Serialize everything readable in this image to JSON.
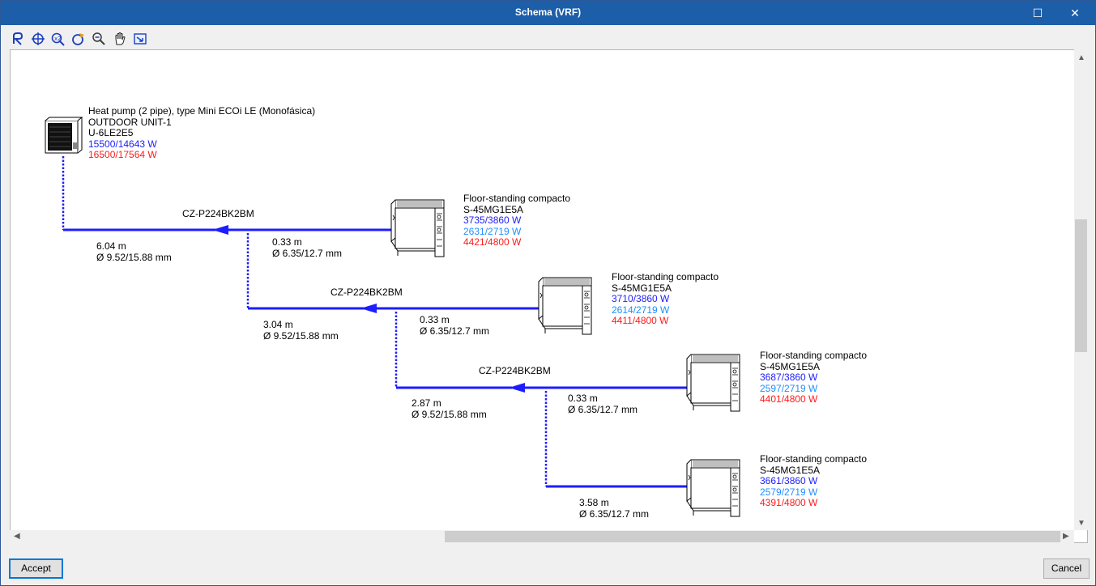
{
  "window": {
    "title": "Schema (VRF)",
    "maximize_glyph": "☐",
    "close_glyph": "✕"
  },
  "toolbar": {
    "tools": [
      "zoom-previous-icon",
      "zoom-extents-icon",
      "zoom-window-icon",
      "refresh-icon",
      "zoom-out-icon",
      "pan-hand-icon",
      "export-icon"
    ]
  },
  "outdoor_unit": {
    "type": "Heat pump (2 pipe), type Mini ECOi LE (Monofásica)",
    "name": "OUTDOOR UNIT-1",
    "model": "U-6LE2E5",
    "cooling": "15500/14643 W",
    "heating": "16500/17564 W"
  },
  "branches": [
    {
      "label": "CZ-P224BK2BM",
      "length": "6.04 m",
      "diameter": "Ø 9.52/15.88 mm"
    },
    {
      "label": "CZ-P224BK2BM",
      "length": "3.04 m",
      "diameter": "Ø 9.52/15.88 mm"
    },
    {
      "label": "CZ-P224BK2BM",
      "length": "2.87 m",
      "diameter": "Ø 9.52/15.88 mm"
    }
  ],
  "indoor_units": [
    {
      "type": "Floor-standing compacto",
      "model": "S-45MG1E5A",
      "total": "3735/3860 W",
      "sensible": "2631/2719 W",
      "heating": "4421/4800 W",
      "pipe_length": "0.33 m",
      "pipe_diameter": "Ø 6.35/12.7 mm"
    },
    {
      "type": "Floor-standing compacto",
      "model": "S-45MG1E5A",
      "total": "3710/3860 W",
      "sensible": "2614/2719 W",
      "heating": "4411/4800 W",
      "pipe_length": "0.33 m",
      "pipe_diameter": "Ø 6.35/12.7 mm"
    },
    {
      "type": "Floor-standing compacto",
      "model": "S-45MG1E5A",
      "total": "3687/3860 W",
      "sensible": "2597/2719 W",
      "heating": "4401/4800 W",
      "pipe_length": "0.33 m",
      "pipe_diameter": "Ø 6.35/12.7 mm"
    },
    {
      "type": "Floor-standing compacto",
      "model": "S-45MG1E5A",
      "total": "3661/3860 W",
      "sensible": "2579/2719 W",
      "heating": "4391/4800 W",
      "pipe_length": "3.58 m",
      "pipe_diameter": "Ø 6.35/12.7 mm"
    }
  ],
  "colors": {
    "title_bar": "#1c5ea8",
    "pipe": "#1d1dff",
    "cooling_text": "#1d1dff",
    "sensible_text": "#1e8fff",
    "heating_text": "#ff1a1a"
  },
  "buttons": {
    "accept": "Accept",
    "cancel": "Cancel"
  }
}
